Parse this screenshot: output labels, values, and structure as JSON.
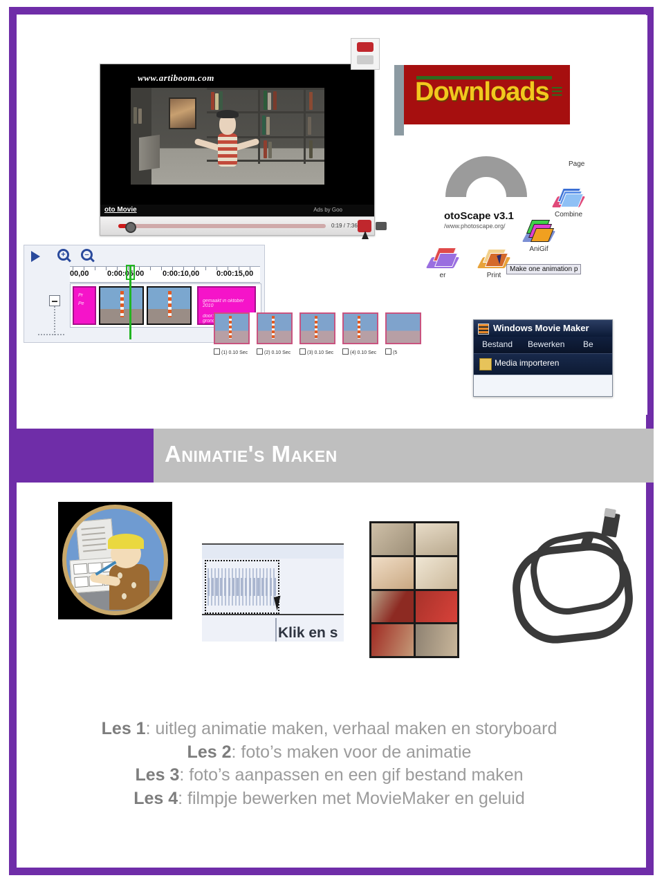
{
  "page": {
    "border_color": "#6f2da8",
    "background": "#ffffff"
  },
  "title_banner": {
    "title": "Animatie's Maken",
    "purple_color": "#6f2da8",
    "grey_color": "#bfbfbf",
    "text_color": "#ffffff"
  },
  "collage": {
    "video_player": {
      "watermark": "www.artiboom.com",
      "video_title": "oto Movie",
      "ads_label": "Ads by Goo",
      "time_display": "0:19 / 7:36"
    },
    "timeline_editor": {
      "play_icon": "play-icon",
      "zoom_in_icon": "zoom-in-icon",
      "zoom_out_icon": "zoom-out-icon",
      "zoom_in_sign": "+",
      "zoom_out_sign": "–",
      "ruler_labels": [
        "00,00",
        "0:00:05,00",
        "0:00:10,00",
        "0:00:15,00"
      ],
      "clip_text_1": "Pr",
      "clip_text_2": "Pe",
      "clip_text_3": "gemaakt in oktober 2010",
      "clip_text_4": "door: onderzoek en grondslag"
    },
    "downloads_banner": {
      "text": "Downloads",
      "accent": "≡",
      "background": "#a60f0f",
      "text_color": "#f2c81e",
      "rule_color": "#2e6b1e"
    },
    "photoscape": {
      "app_title": "otoScape v3.1",
      "url": "/www.photoscape.org/",
      "label_page": "Page",
      "label_combine": "Combine",
      "label_anigif": "AniGif",
      "label_print": "Print",
      "label_partial": "er",
      "tooltip": "Make one animation p"
    },
    "filmstrip": {
      "frames": [
        "(1) 0.10 Sec",
        "(2) 0.10 Sec",
        "(3) 0.10 Sec",
        "(4) 0.10 Sec",
        "(5"
      ]
    },
    "movie_maker": {
      "window_title": "Windows Movie Maker",
      "menu_items": [
        "Bestand",
        "Bewerken",
        "Be"
      ],
      "toolbar_item": "Media importeren"
    }
  },
  "figures": {
    "cartoon": "storyboard-artist-cartoon",
    "audio_editor_text": "Klik en s",
    "comic": "comic-storyboard-grid",
    "usb_cable": "usb-cable-photo"
  },
  "lessons": [
    {
      "prefix": "Les 1",
      "text": ": uitleg animatie maken, verhaal maken en storyboard"
    },
    {
      "prefix": "Les 2",
      "text": ": foto’s maken voor de animatie"
    },
    {
      "prefix": "Les 3",
      "text": ": foto’s aanpassen en een gif bestand maken"
    },
    {
      "prefix": "Les 4",
      "text": ": filmpje bewerken met MovieMaker en geluid"
    }
  ]
}
